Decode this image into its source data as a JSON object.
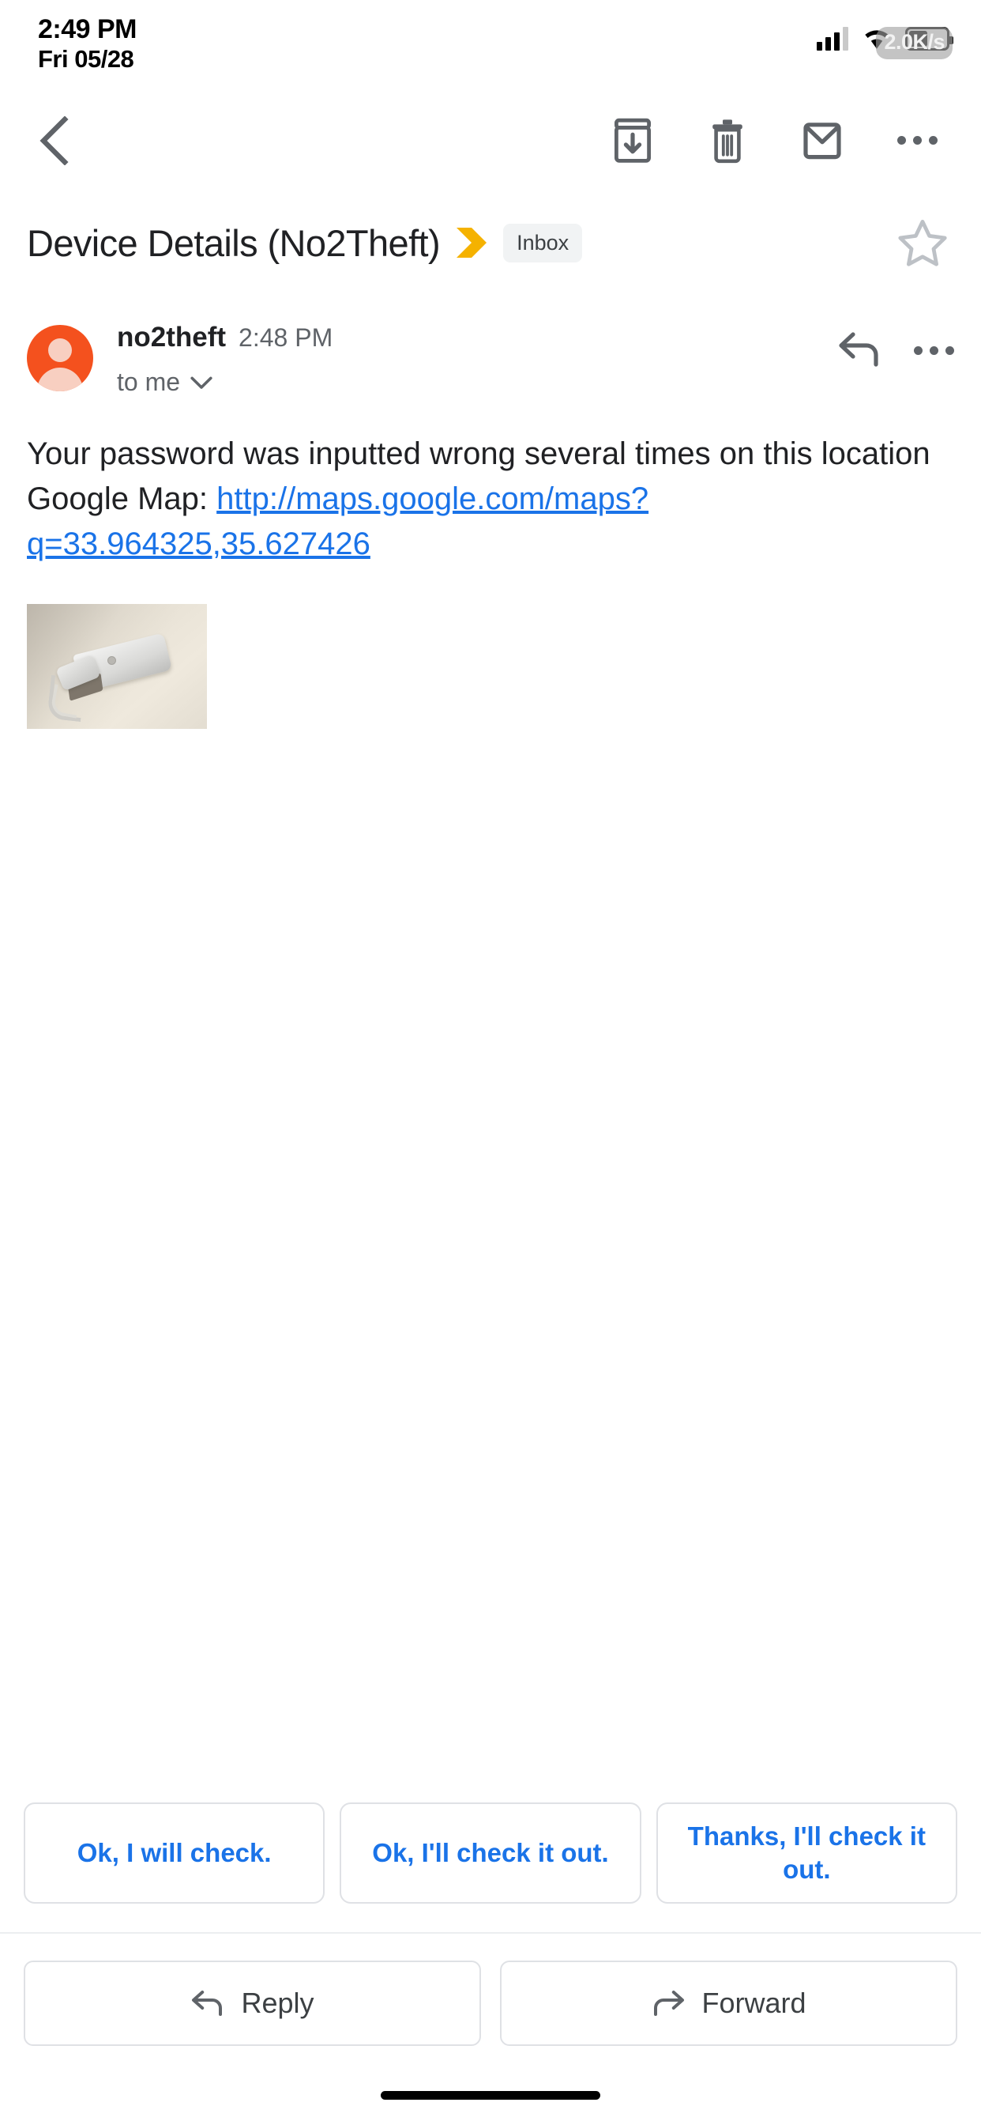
{
  "status_bar": {
    "time": "2:49 PM",
    "date": "Fri 05/28",
    "network_speed": "2.0K/s",
    "icons": [
      "signal-bars-icon",
      "wifi-icon",
      "battery-icon"
    ]
  },
  "toolbar": {
    "back_label": "Back",
    "archive_label": "Archive",
    "delete_label": "Delete",
    "mark_unread_label": "Mark unread",
    "more_label": "More options"
  },
  "subject": {
    "text": "Device Details (No2Theft)",
    "important_marker": "important-chevron-icon",
    "label_chip": "Inbox",
    "star_state": "not-starred",
    "important_color": "#f5b200",
    "chip_bg": "#f1f3f4"
  },
  "message": {
    "sender": "no2theft",
    "time": "2:48 PM",
    "recipients": "to me",
    "avatar_color": "#f4511e",
    "body_line_1": "Your password was inputted wrong several times on this location",
    "body_prefix_2": "Google Map: ",
    "link_text": "http://maps.google.com/maps?q=33.964325,35.627426",
    "link_color": "#1a73e8",
    "attachment_alt": "Photo of a wall-mounted telephone handset"
  },
  "smart_replies": [
    "Ok, I will check.",
    "Ok, I'll check it out.",
    "Thanks, I'll check it out."
  ],
  "bottom_actions": {
    "reply": "Reply",
    "forward": "Forward"
  }
}
